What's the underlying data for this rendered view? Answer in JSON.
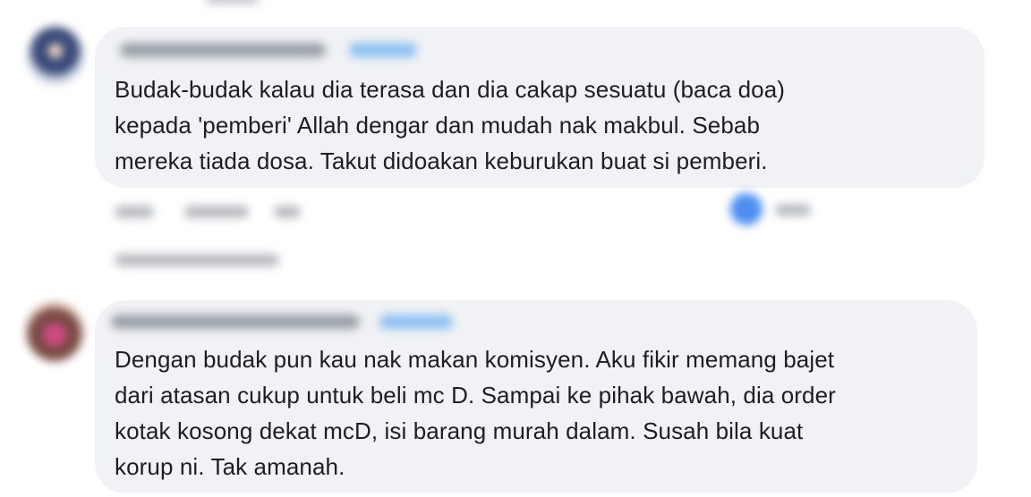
{
  "comments": [
    {
      "author": "",
      "follow_label": "",
      "text": "Budak-budak kalau dia terasa dan dia cakap sesuatu (baca doa)\nkepada 'pemberi' Allah dengar dan mudah nak makbul. Sebab\nmereka tiada dosa. Takut didoakan keburukan buat si pemberi.",
      "actions": [
        "",
        "",
        ""
      ],
      "reaction_count": "",
      "replies_label": ""
    },
    {
      "author": "",
      "follow_label": "",
      "text": "Dengan budak pun kau nak makan komisyen. Aku fikir memang bajet\ndari atasan cukup untuk beli mc D. Sampai ke pihak bawah, dia order\nkotak kosong dekat mcD, isi barang murah dalam. Susah bila kuat\nkorup ni. Tak amanah."
    }
  ],
  "colors": {
    "bubble": "#f0f2f5",
    "text": "#1c1e21",
    "follow": "#8fbff2",
    "reaction": "#4d8ef0"
  },
  "icons": [
    "avatar",
    "like-reaction-icon"
  ]
}
